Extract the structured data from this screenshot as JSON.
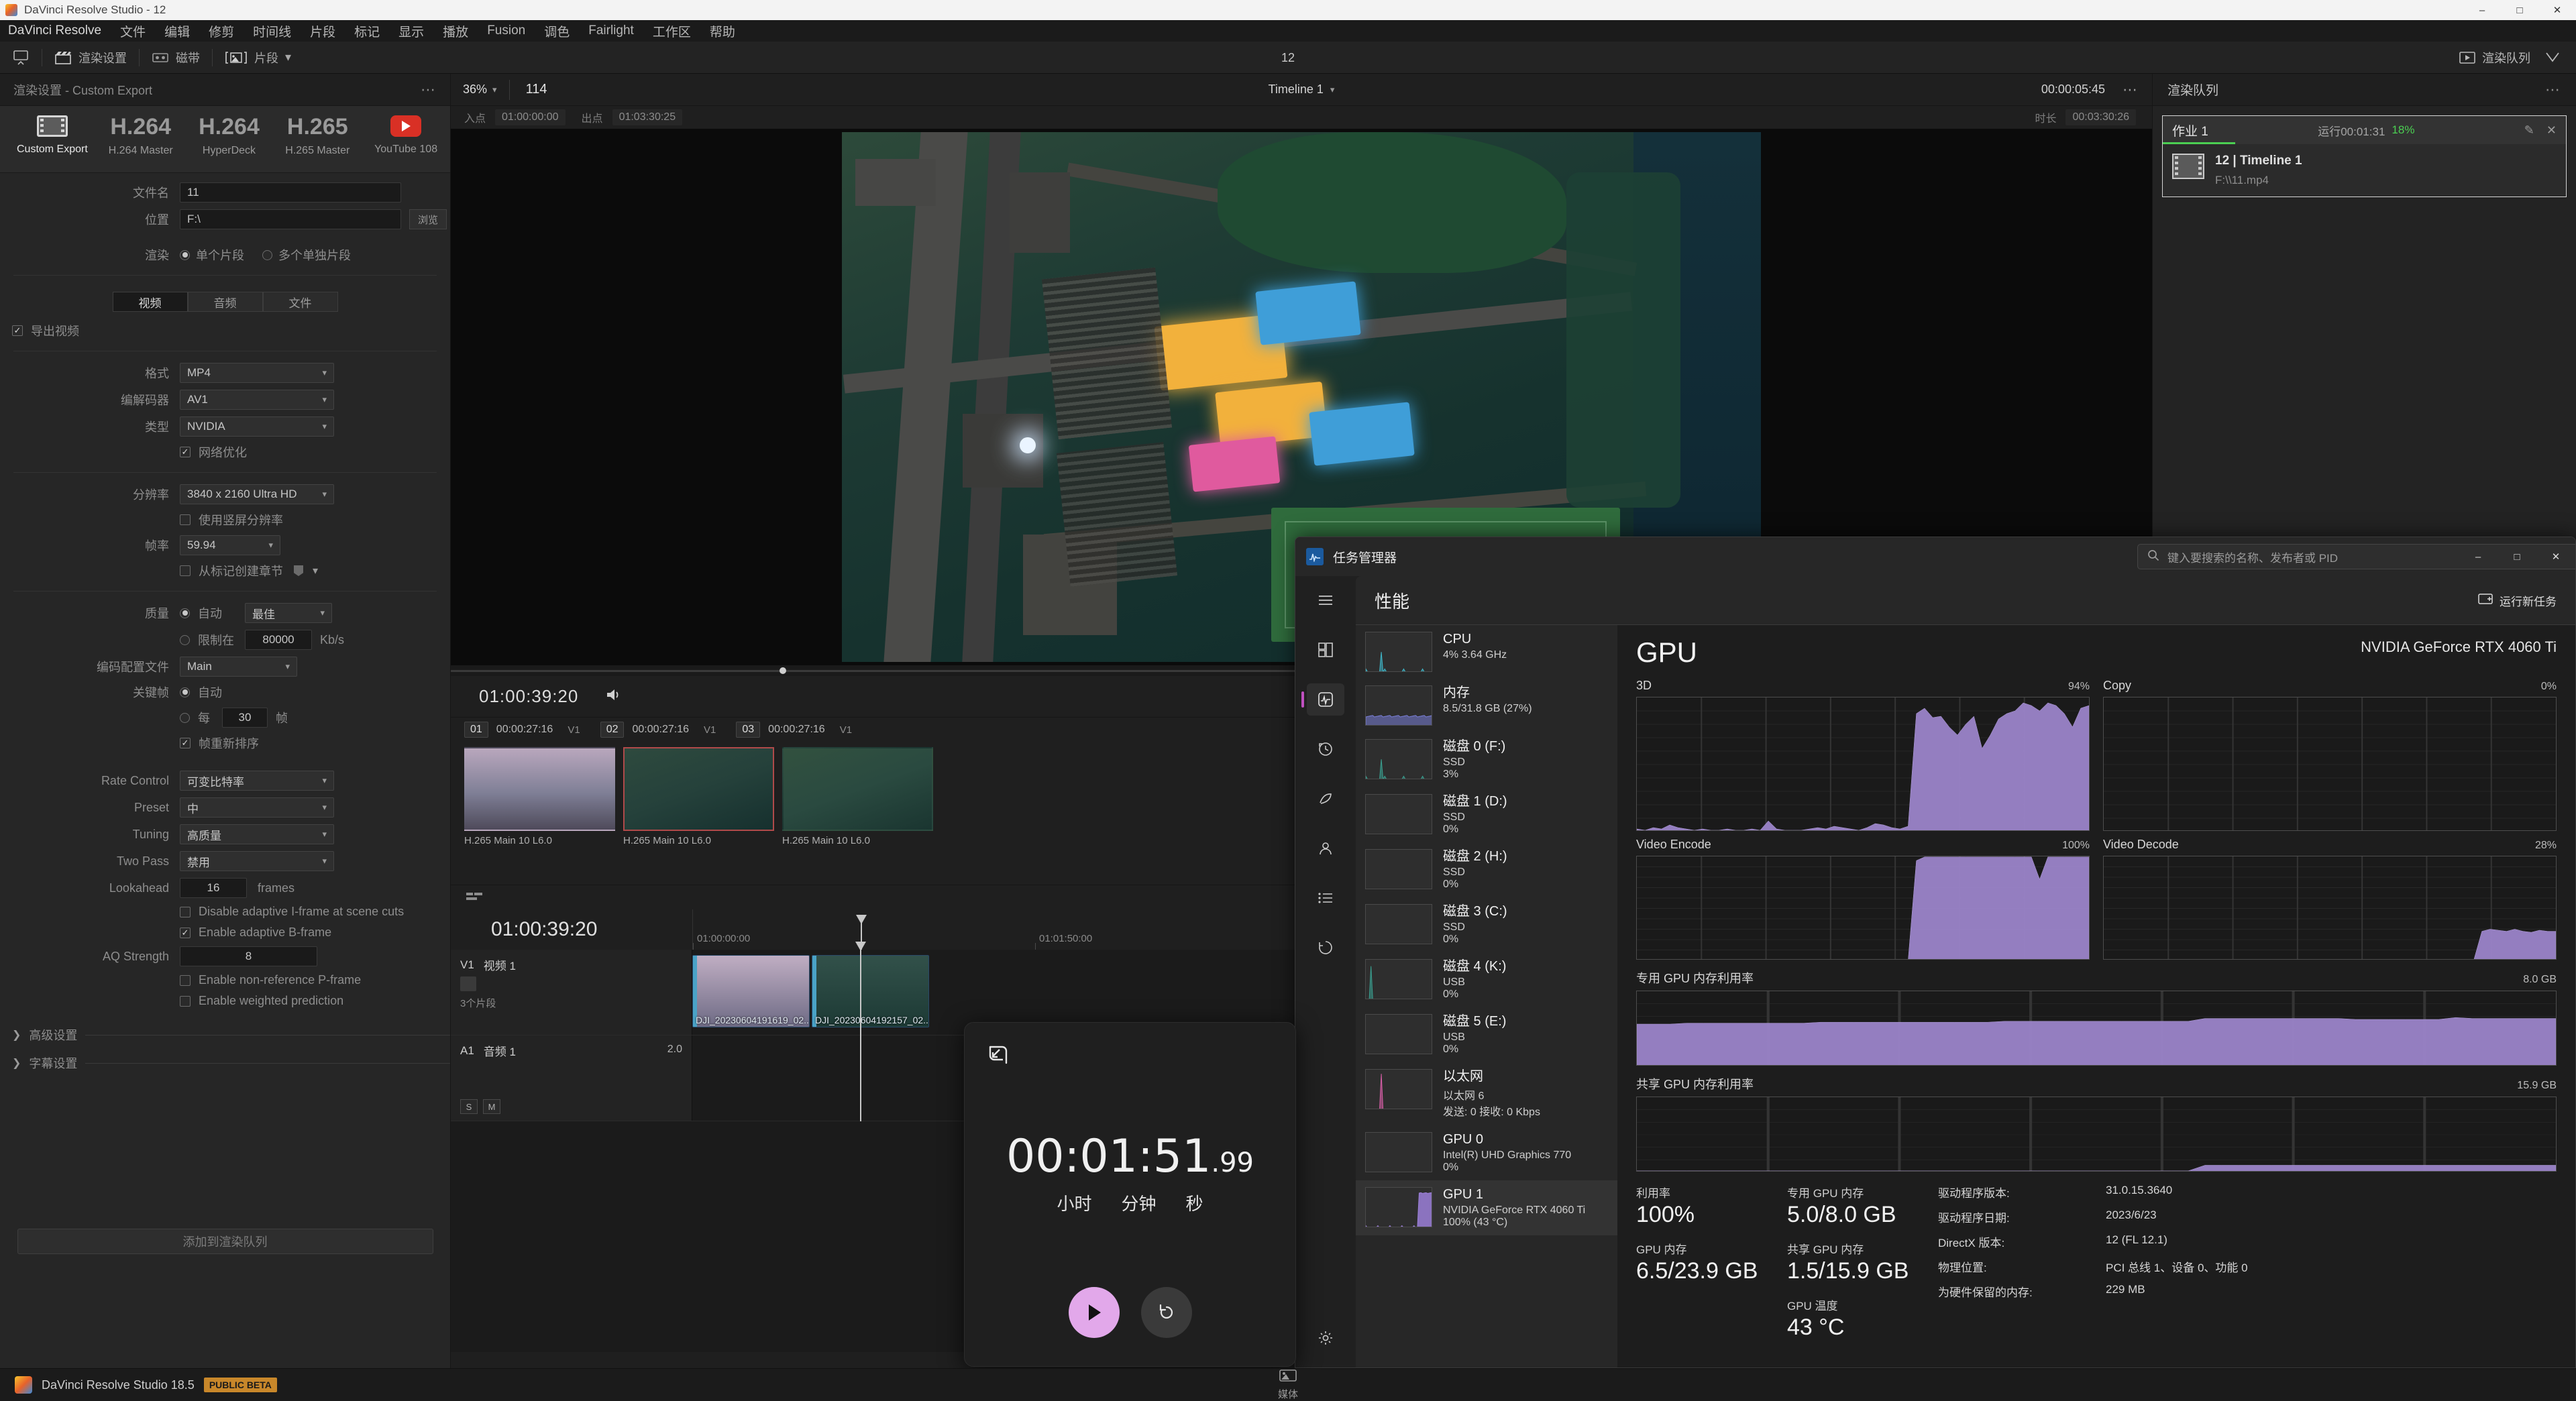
{
  "window": {
    "title": "DaVinci Resolve Studio - 12",
    "controls": [
      "–",
      "□",
      "✕"
    ]
  },
  "menubar": {
    "items": [
      "DaVinci Resolve",
      "文件",
      "编辑",
      "修剪",
      "时间线",
      "片段",
      "标记",
      "显示",
      "播放",
      "Fusion",
      "调色",
      "Fairlight",
      "工作区",
      "帮助"
    ]
  },
  "toolbar": {
    "render_settings": "渲染设置",
    "tape": "磁带",
    "clip": "片段",
    "project_number": "12",
    "render_queue_button": "渲染队列"
  },
  "render_settings": {
    "header": "渲染设置 - Custom Export",
    "presets": [
      {
        "name": "Custom Export",
        "big": "",
        "icon": "film-icon",
        "selected": true
      },
      {
        "name": "H.264 Master",
        "big": "H.264",
        "icon": "",
        "selected": false
      },
      {
        "name": "HyperDeck",
        "big": "H.264",
        "icon": "",
        "selected": false
      },
      {
        "name": "H.265 Master",
        "big": "H.265",
        "icon": "",
        "selected": false
      },
      {
        "name": "YouTube 108",
        "big": "",
        "icon": "youtube-icon",
        "selected": false
      }
    ],
    "filename_label": "文件名",
    "filename_value": "11",
    "location_label": "位置",
    "location_value": "F:\\",
    "browse_label": "浏览",
    "render_label": "渲染",
    "render_option_single": "单个片段",
    "render_option_multi": "多个单独片段",
    "tabs": [
      "视频",
      "音频",
      "文件"
    ],
    "tab_active": "视频",
    "export_video_label": "导出视频",
    "export_video_checked": true,
    "format_label": "格式",
    "format_value": "MP4",
    "codec_label": "编解码器",
    "codec_value": "AV1",
    "type_label": "类型",
    "type_value": "NVIDIA",
    "network_opt_label": "网络优化",
    "network_opt_checked": true,
    "resolution_label": "分辨率",
    "resolution_value": "3840 x 2160 Ultra HD",
    "vertical_res_label": "使用竖屏分辨率",
    "vertical_res_checked": false,
    "framerate_label": "帧率",
    "framerate_value": "59.94",
    "chapters_label": "从标记创建章节",
    "chapters_checked": false,
    "quality_label": "质量",
    "quality_auto_label": "自动",
    "quality_auto_value": "最佳",
    "quality_auto_selected": true,
    "quality_limit_label": "限制在",
    "quality_limit_value": "80000",
    "quality_limit_unit": "Kb/s",
    "profile_label": "编码配置文件",
    "profile_value": "Main",
    "keyframe_label": "关键帧",
    "keyframe_auto_label": "自动",
    "keyframe_auto_selected": true,
    "keyframe_every_label": "每",
    "keyframe_every_value": "30",
    "keyframe_every_unit": "帧",
    "frame_reorder_label": "帧重新排序",
    "frame_reorder_checked": true,
    "rate_control_label": "Rate Control",
    "rate_control_value": "可变比特率",
    "preset_label": "Preset",
    "preset_value": "中",
    "tuning_label": "Tuning",
    "tuning_value": "高质量",
    "two_pass_label": "Two Pass",
    "two_pass_value": "禁用",
    "lookahead_label": "Lookahead",
    "lookahead_value": "16",
    "lookahead_unit": "frames",
    "disable_iframe_label": "Disable adaptive I-frame at scene cuts",
    "disable_iframe_checked": false,
    "adaptive_bframe_label": "Enable adaptive B-frame",
    "adaptive_bframe_checked": true,
    "aq_strength_label": "AQ Strength",
    "aq_strength_value": "8",
    "nonref_pframe_label": "Enable non-reference P-frame",
    "nonref_pframe_checked": false,
    "weighted_pred_label": "Enable weighted prediction",
    "weighted_pred_checked": false,
    "advanced_settings": "高级设置",
    "subtitle_settings": "字幕设置",
    "add_to_queue": "添加到渲染队列"
  },
  "viewer": {
    "zoom": "36%",
    "frame_number": "114",
    "timeline_name": "Timeline 1",
    "timecode_right": "00:00:05:45",
    "in_label": "入点",
    "in_value": "01:00:00:00",
    "out_label": "出点",
    "out_value": "01:03:30:25",
    "duration_label": "时长",
    "duration_value": "00:03:30:26",
    "playhead_timecode": "01:00:39:20"
  },
  "clip_strip": {
    "timecode": "01:00:39:20",
    "clips": [
      {
        "index": "01",
        "tc": "00:00:27:16",
        "track": "V1",
        "caption": "H.265 Main 10 L6.0",
        "selected": false
      },
      {
        "index": "02",
        "tc": "00:00:27:16",
        "track": "V1",
        "caption": "H.265 Main 10 L6.0",
        "selected": true
      },
      {
        "index": "03",
        "tc": "00:00:27:16",
        "track": "V1",
        "caption": "H.265 Main 10 L6.0",
        "selected": false
      }
    ]
  },
  "timeline": {
    "timecode": "01:00:39:20",
    "ruler_ticks": [
      "01:00:00:00",
      "01:01:50:00"
    ],
    "tracks": [
      {
        "id": "V1",
        "name": "视频 1",
        "sub": "3个片段",
        "right": "",
        "clips": [
          {
            "label": "DJI_20230604191619_02...",
            "left": 0,
            "width": 175
          },
          {
            "label": "DJI_20230604192157_02...",
            "left": 178,
            "width": 175
          }
        ]
      },
      {
        "id": "A1",
        "name": "音频 1",
        "sub": "",
        "right": "2.0",
        "buttons": [
          "S",
          "M"
        ],
        "clips": []
      }
    ]
  },
  "render_queue": {
    "title": "渲染队列",
    "job_name": "作业 1",
    "eta_label": "运行",
    "eta_value": "00:01:31",
    "progress_pct": "18%",
    "progress_value": 18,
    "file_title": "12 | Timeline 1",
    "file_path": "F:\\\\11.mp4"
  },
  "task_manager": {
    "title": "任务管理器",
    "search_placeholder": "键入要搜索的名称、发布者或 PID",
    "page_title": "性能",
    "run_new_task": "运行新任务",
    "window_controls": [
      "–",
      "□",
      "✕"
    ],
    "list": [
      {
        "name": "CPU",
        "sub": "4%  3.64 GHz",
        "sub2": "",
        "color": "#3fb6c8",
        "active": false,
        "level": 4
      },
      {
        "name": "内存",
        "sub": "8.5/31.8 GB (27%)",
        "sub2": "",
        "color": "#7a7fd8",
        "active": false,
        "level": 27
      },
      {
        "name": "磁盘 0 (F:)",
        "sub": "SSD",
        "sub2": "3%",
        "color": "#3a9e8f",
        "active": false,
        "level": 3
      },
      {
        "name": "磁盘 1 (D:)",
        "sub": "SSD",
        "sub2": "0%",
        "color": "#3a9e8f",
        "active": false,
        "level": 0
      },
      {
        "name": "磁盘 2 (H:)",
        "sub": "SSD",
        "sub2": "0%",
        "color": "#3a9e8f",
        "active": false,
        "level": 0
      },
      {
        "name": "磁盘 3 (C:)",
        "sub": "SSD",
        "sub2": "0%",
        "color": "#3a9e8f",
        "active": false,
        "level": 0
      },
      {
        "name": "磁盘 4 (K:)",
        "sub": "USB",
        "sub2": "0%",
        "color": "#3a9e8f",
        "active": false,
        "level": 0
      },
      {
        "name": "磁盘 5 (E:)",
        "sub": "USB",
        "sub2": "0%",
        "color": "#3a9e8f",
        "active": false,
        "level": 0
      },
      {
        "name": "以太网",
        "sub": "以太网 6",
        "sub2": "发送: 0 接收: 0 Kbps",
        "color": "#d85fa8",
        "active": false,
        "level": 0
      },
      {
        "name": "GPU 0",
        "sub": "Intel(R) UHD Graphics 770",
        "sub2": "0%",
        "color": "#9b7fd8",
        "active": false,
        "level": 0
      },
      {
        "name": "GPU 1",
        "sub": "NVIDIA GeForce RTX 4060 Ti",
        "sub2": "100%  (43 °C)",
        "color": "#9b7fd8",
        "active": true,
        "level": 100
      }
    ],
    "gpu_detail": {
      "heading": "GPU",
      "model": "NVIDIA GeForce RTX 4060 Ti",
      "panels": [
        {
          "label": "3D",
          "value": "94%"
        },
        {
          "label": "Copy",
          "value": "0%"
        },
        {
          "label": "Video Encode",
          "value": "100%"
        },
        {
          "label": "Video Decode",
          "value": "28%"
        }
      ],
      "dedicated_mem_label": "专用 GPU 内存利用率",
      "dedicated_mem_max": "8.0 GB",
      "shared_mem_label": "共享 GPU 内存利用率",
      "shared_mem_max": "15.9 GB",
      "stats": [
        {
          "label": "利用率",
          "value": "100%"
        },
        {
          "label": "GPU 内存",
          "value": "6.5/23.9 GB"
        },
        {
          "label": "专用 GPU 内存",
          "value": "5.0/8.0 GB"
        },
        {
          "label": "共享 GPU 内存",
          "value": "1.5/15.9 GB"
        },
        {
          "label": "GPU 温度",
          "value": "43 °C"
        }
      ],
      "info": [
        {
          "label": "驱动程序版本:",
          "value": "31.0.15.3640"
        },
        {
          "label": "驱动程序日期:",
          "value": "2023/6/23"
        },
        {
          "label": "DirectX 版本:",
          "value": "12 (FL 12.1)"
        },
        {
          "label": "物理位置:",
          "value": "PCI 总线 1、设备 0、功能 0"
        },
        {
          "label": "为硬件保留的内存:",
          "value": "229 MB"
        }
      ]
    }
  },
  "timer_overlay": {
    "time": "00:01:51",
    "ms": ".99",
    "units": [
      "小时",
      "分钟",
      "秒"
    ],
    "play_icon": "play-icon",
    "reset_icon": "reset-icon"
  },
  "statusbar": {
    "app_name": "DaVinci Resolve Studio 18.5",
    "beta_badge": "PUBLIC BETA",
    "center_label": "媒体"
  },
  "chart_data": [
    {
      "type": "area",
      "title": "3D",
      "ylabel": "%",
      "ylim": [
        0,
        100
      ],
      "grid": true,
      "values": [
        2,
        1,
        3,
        2,
        5,
        3,
        2,
        1,
        2,
        1,
        1,
        2,
        1,
        1,
        2,
        1,
        8,
        2,
        1,
        1,
        1,
        2,
        3,
        2,
        4,
        3,
        2,
        1,
        3,
        6,
        5,
        3,
        2,
        4,
        88,
        92,
        85,
        86,
        78,
        72,
        80,
        86,
        62,
        72,
        84,
        88,
        90,
        96,
        94,
        90,
        96,
        94,
        88,
        78,
        92,
        94
      ]
    },
    {
      "type": "area",
      "title": "Copy",
      "ylabel": "%",
      "ylim": [
        0,
        100
      ],
      "grid": true,
      "values": [
        0,
        0,
        0,
        0,
        0,
        0,
        0,
        0,
        0,
        0,
        0,
        0,
        0,
        0,
        0,
        0,
        0,
        0,
        0,
        0,
        0,
        0,
        0,
        0,
        0,
        0,
        0,
        0,
        0,
        0,
        0,
        0,
        0,
        0,
        0,
        0,
        0,
        0,
        0,
        0,
        0,
        0,
        0,
        0,
        0,
        0,
        0,
        0,
        0,
        0,
        0,
        0,
        0,
        0,
        0,
        0
      ]
    },
    {
      "type": "area",
      "title": "Video Encode",
      "ylabel": "%",
      "ylim": [
        0,
        100
      ],
      "grid": true,
      "values": [
        0,
        0,
        0,
        0,
        0,
        0,
        0,
        0,
        0,
        0,
        0,
        0,
        0,
        0,
        0,
        0,
        0,
        0,
        0,
        0,
        0,
        0,
        0,
        0,
        0,
        0,
        0,
        0,
        0,
        0,
        0,
        0,
        0,
        0,
        96,
        100,
        100,
        100,
        100,
        100,
        100,
        100,
        100,
        100,
        100,
        100,
        100,
        100,
        100,
        78,
        100,
        100,
        100,
        100,
        100,
        100
      ]
    },
    {
      "type": "area",
      "title": "Video Decode",
      "ylabel": "%",
      "ylim": [
        0,
        100
      ],
      "grid": true,
      "values": [
        0,
        0,
        0,
        0,
        0,
        0,
        0,
        0,
        0,
        0,
        0,
        0,
        0,
        0,
        0,
        0,
        0,
        0,
        0,
        0,
        0,
        0,
        0,
        0,
        0,
        0,
        0,
        0,
        0,
        0,
        0,
        0,
        0,
        0,
        0,
        0,
        0,
        0,
        0,
        0,
        0,
        0,
        0,
        0,
        0,
        0,
        28,
        30,
        29,
        28,
        30,
        28,
        27,
        29,
        28,
        28
      ]
    },
    {
      "type": "area",
      "title": "专用 GPU 内存利用率",
      "ylabel": "GB",
      "ylim": [
        0,
        8.0
      ],
      "grid": true,
      "values": [
        4.5,
        4.5,
        4.5,
        4.6,
        4.6,
        4.6,
        4.6,
        4.6,
        4.6,
        4.6,
        4.6,
        4.7,
        4.7,
        4.7,
        4.7,
        4.7,
        4.7,
        4.7,
        4.7,
        4.7,
        4.7,
        4.7,
        4.8,
        4.8,
        4.8,
        4.8,
        4.8,
        4.8,
        4.8,
        4.8,
        4.8,
        4.8,
        4.8,
        4.8,
        5.1,
        5.1,
        5.1,
        5.1,
        5.1,
        5.1,
        5.1,
        5.1,
        5.1,
        5.0,
        5.0,
        5.0,
        5.0,
        5.0,
        5.0,
        5.2,
        5.1,
        5.1,
        5.1,
        5.1,
        5.1,
        5.1
      ]
    },
    {
      "type": "area",
      "title": "共享 GPU 内存利用率",
      "ylabel": "GB",
      "ylim": [
        0,
        15.9
      ],
      "grid": true,
      "values": [
        0.3,
        0.3,
        0.3,
        0.3,
        0.3,
        0.3,
        0.3,
        0.3,
        0.3,
        0.3,
        0.3,
        0.3,
        0.3,
        0.3,
        0.3,
        0.3,
        0.3,
        0.3,
        0.3,
        0.3,
        0.3,
        0.3,
        0.3,
        0.3,
        0.3,
        0.3,
        0.3,
        0.3,
        0.3,
        0.3,
        0.3,
        0.3,
        0.3,
        0.3,
        1.5,
        1.5,
        1.5,
        1.5,
        1.5,
        1.5,
        1.5,
        1.5,
        1.5,
        1.5,
        1.5,
        1.5,
        1.5,
        1.5,
        1.5,
        1.5,
        1.5,
        1.5,
        1.5,
        1.5,
        1.5,
        1.5
      ]
    }
  ]
}
